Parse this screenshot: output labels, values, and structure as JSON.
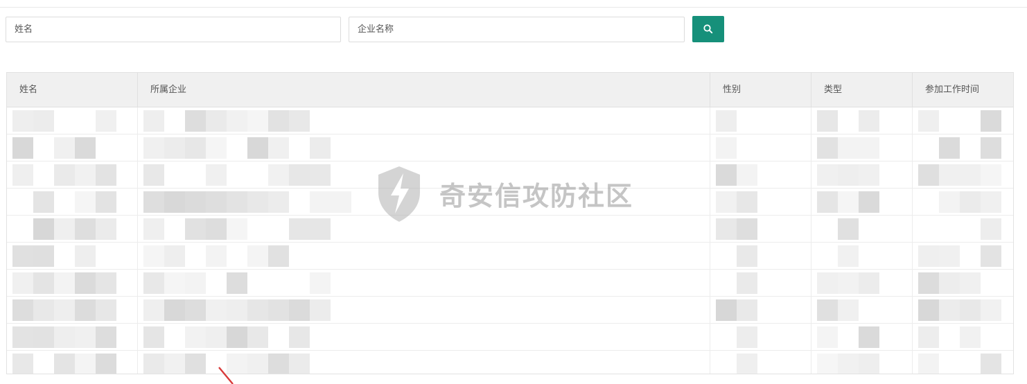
{
  "filters": {
    "name_placeholder": "姓名",
    "company_placeholder": "企业名称",
    "search_icon": "search-icon",
    "accent_color": "#16907a"
  },
  "table": {
    "headers": [
      "姓名",
      "所属企业",
      "性别",
      "类型",
      "参加工作时间"
    ]
  },
  "watermark": {
    "text": "奇安信攻防社区",
    "icon": "lightning-shield-icon"
  }
}
